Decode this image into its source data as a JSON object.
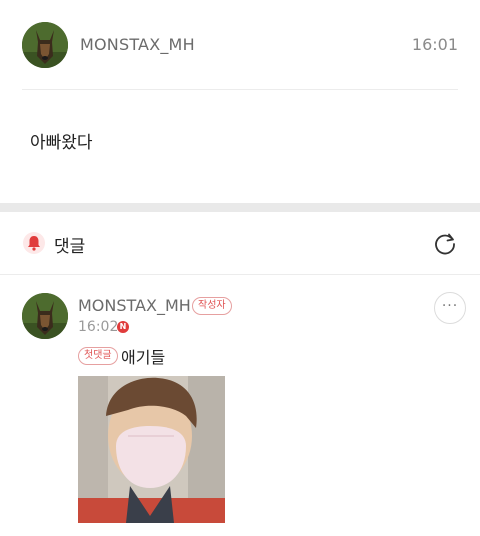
{
  "post": {
    "author": "MONSTAX_MH",
    "time": "16:01",
    "body": "아빠왔다"
  },
  "comments_section": {
    "title": "댓글"
  },
  "comment": {
    "author": "MONSTAX_MH",
    "writer_badge": "작성자",
    "time": "16:02",
    "new_badge": "N",
    "first_badge": "첫댓글",
    "text": "애기들",
    "more_label": "···"
  },
  "icons": {
    "bell": "bell-icon",
    "refresh": "refresh-icon",
    "more": "more-icon"
  },
  "colors": {
    "accent": "#e03c3c",
    "badge_border": "#e6a0a0",
    "section_gap": "#e9e9e9"
  }
}
